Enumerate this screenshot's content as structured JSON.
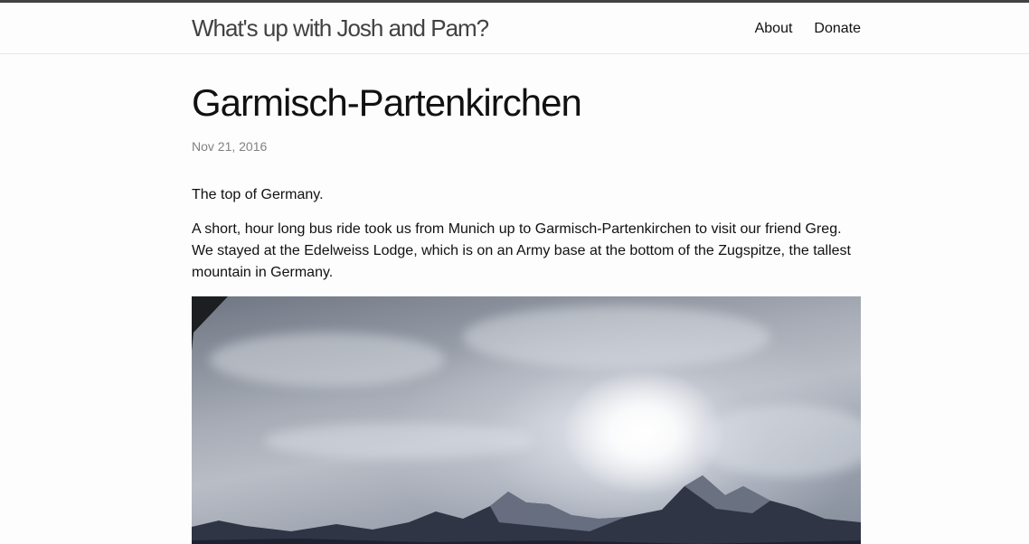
{
  "header": {
    "site_title": "What's up with Josh and Pam?",
    "nav": [
      {
        "label": "About"
      },
      {
        "label": "Donate"
      }
    ]
  },
  "post": {
    "title": "Garmisch-Partenkirchen",
    "date": "Nov 21, 2016",
    "paragraphs": [
      "The top of Germany.",
      "A short, hour long bus ride took us from Munich up to Garmisch-Partenkirchen to visit our friend Greg. We stayed at the Edelweiss Lodge, which is on an Army base at the bottom of the Zugspitze, the tallest mountain in Germany."
    ],
    "image_subject": "cloudy-sky-over-mountains-photo"
  },
  "colors": {
    "accent_bar": "#424242",
    "title_text": "#424242",
    "meta_text": "#828282",
    "body_text": "#111111",
    "background": "#fdfdfd"
  }
}
